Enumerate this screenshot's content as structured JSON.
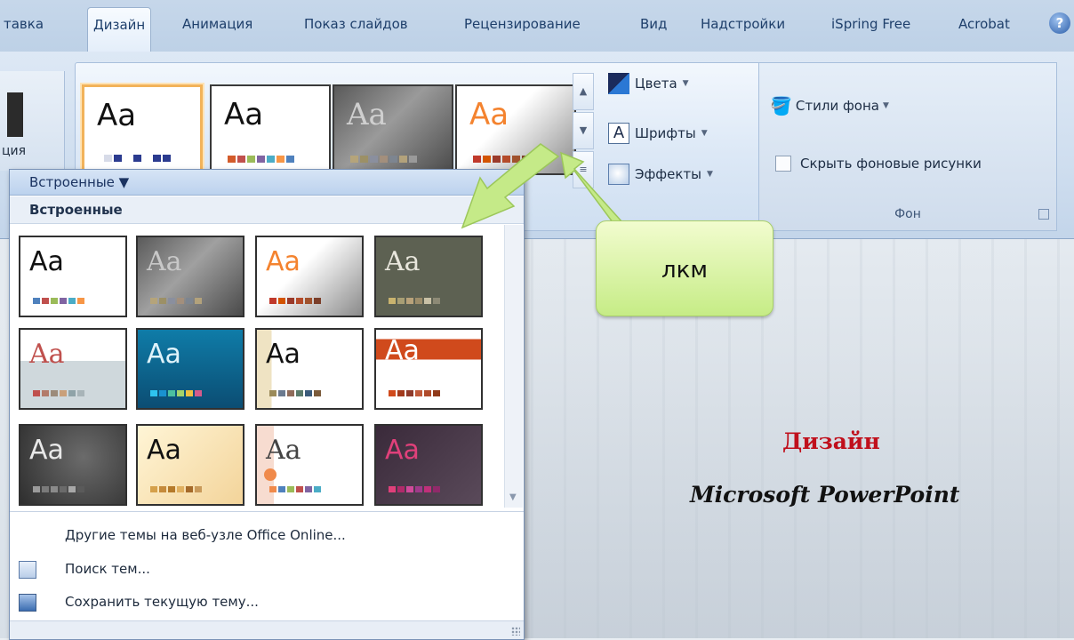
{
  "ribbon_tabs": [
    "тавка",
    "Дизайн",
    "Анимация",
    "Показ слайдов",
    "Рецензирование",
    "Вид",
    "Надстройки",
    "iSpring Free",
    "Acrobat"
  ],
  "left_fragment": {
    "label": "ция"
  },
  "theme_thumb_text": "Aa",
  "design_commands": {
    "colors": "Цвета",
    "fonts": "Шрифты",
    "effects": "Эффекты",
    "fonts_icon_letter": "A"
  },
  "background_group": {
    "styles": "Стили фона",
    "hide_graphics": "Скрыть фоновые рисунки",
    "hide_graphics_checked": false,
    "group_label": "Фон"
  },
  "dropdown": {
    "header": "Встроенные ▼",
    "section_title": "Встроенные",
    "menu_items": [
      {
        "label": "Другие темы на веб-узле Office Online...",
        "icon": "none"
      },
      {
        "label": "Поиск тем...",
        "icon": "folder-browse-icon"
      },
      {
        "label": "Сохранить текущую тему...",
        "icon": "save-theme-icon"
      }
    ]
  },
  "callout": {
    "text": "лкм"
  },
  "slide": {
    "title": "Дизайн",
    "subtitle": "Microsoft PowerPoint"
  },
  "colors": {
    "ribbon_blue": "#c6d7ea",
    "selected_outline": "#f2b35a",
    "callout_green": "#c6ec86",
    "arrow_green": "#b9e37a",
    "slide_title_red": "#c0101c"
  }
}
